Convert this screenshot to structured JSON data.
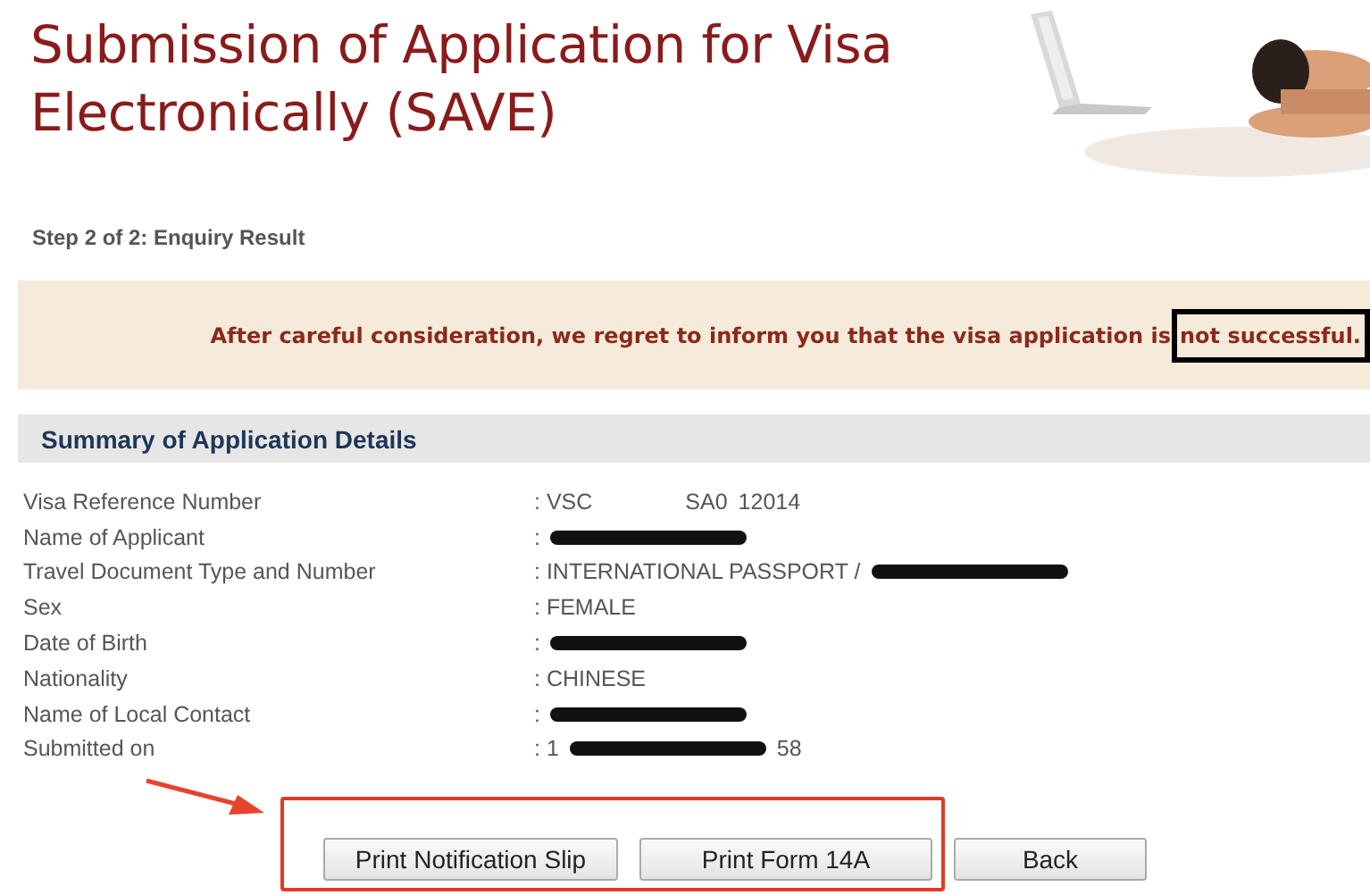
{
  "header": {
    "title": "Submission of Application for Visa Electronically (SAVE)"
  },
  "step": "Step 2 of 2: Enquiry Result",
  "message": {
    "text": "After careful consideration, we regret to inform you that the visa application is ",
    "highlight": "not successful."
  },
  "summary": {
    "heading": "Summary of Application Details",
    "rows": [
      {
        "label": "Visa Reference Number",
        "value": [
          {
            "kind": "text",
            "text": ": VSC"
          },
          {
            "kind": "gap"
          },
          {
            "kind": "text",
            "text": "SA0"
          },
          {
            "kind": "text",
            "text": "12014"
          }
        ]
      },
      {
        "label": "Name of Applicant",
        "value": [
          {
            "kind": "text",
            "text": ":"
          },
          {
            "kind": "redacted"
          }
        ]
      },
      {
        "label": "Travel Document Type and Number",
        "value": [
          {
            "kind": "text",
            "text": ": INTERNATIONAL PASSPORT /"
          },
          {
            "kind": "redacted"
          }
        ]
      },
      {
        "label": "Sex",
        "value": [
          {
            "kind": "text",
            "text": ": FEMALE"
          }
        ]
      },
      {
        "label": "Date of Birth",
        "value": [
          {
            "kind": "text",
            "text": ":"
          },
          {
            "kind": "redacted"
          }
        ]
      },
      {
        "label": "Nationality",
        "value": [
          {
            "kind": "text",
            "text": ": CHINESE"
          }
        ]
      },
      {
        "label": "Name of Local Contact",
        "value": [
          {
            "kind": "text",
            "text": ":"
          },
          {
            "kind": "redacted"
          }
        ]
      },
      {
        "label": "Submitted on",
        "value": [
          {
            "kind": "text",
            "text": ": 1"
          },
          {
            "kind": "redacted"
          },
          {
            "kind": "text",
            "text": "58"
          }
        ]
      }
    ]
  },
  "buttons": [
    "Print Notification Slip",
    "Print Form 14A",
    "Back"
  ]
}
